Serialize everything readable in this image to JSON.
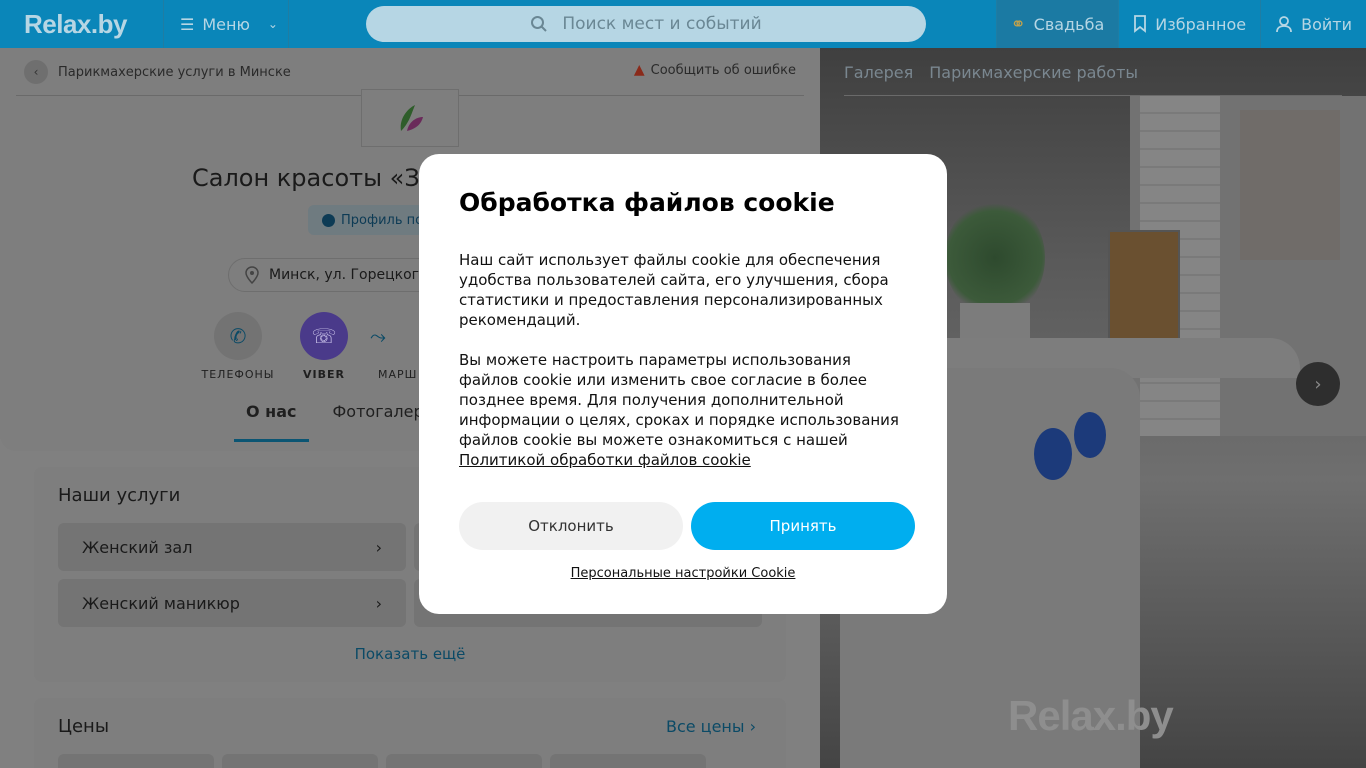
{
  "header": {
    "logo": "Relax.by",
    "menu_label": "Меню",
    "search_placeholder": "Поиск мест и событий",
    "wedding_label": "Свадьба",
    "favorites_label": "Избранное",
    "login_label": "Войти"
  },
  "profile": {
    "breadcrumb": "Парикмахерские услуги в Минске",
    "report_label": "Сообщить об ошибке",
    "title": "Салон красоты «З",
    "verified_label": "Профиль по",
    "address": "Минск, ул. Горецкого",
    "contacts": [
      {
        "label": "ТЕЛЕФОНЫ",
        "icon": "phone-icon"
      },
      {
        "label": "VIBER",
        "icon": "viber-icon"
      },
      {
        "label": "МАРШ",
        "icon": "route-icon"
      }
    ],
    "tabs": [
      {
        "label": "О нас"
      },
      {
        "label": "Фотогалерея"
      }
    ]
  },
  "services": {
    "title": "Наши услуги",
    "items": [
      {
        "label": "Женский зал"
      },
      {
        "label": "Женский маникюр"
      }
    ],
    "show_more": "Показать ещё"
  },
  "prices": {
    "title": "Цены",
    "all_prices": "Все цены"
  },
  "gallery": {
    "nav": [
      "Галерея",
      "Парикмахерские работы"
    ],
    "watermark": "Relax.by"
  },
  "cookie_modal": {
    "title": "Обработка файлов cookie",
    "paragraph1": "Наш сайт использует файлы cookie для обеспечения удобства пользователей сайта, его улучшения, сбора статистики и предоставления персонализированных рекомендаций.",
    "paragraph2": "Вы можете настроить параметры использования файлов cookie или изменить свое согласие в более позднее время. Для получения дополнительной информации о целях, сроках и порядке использования файлов cookie вы можете ознакомиться с нашей",
    "policy_link": "Политикой обработки файлов cookie",
    "decline_label": "Отклонить",
    "accept_label": "Принять",
    "personal_settings": "Персональные настройки Cookie"
  },
  "colors": {
    "header_bg": "#0a86b9",
    "accept_button": "#00aeef",
    "decline_button": "#f1f1f1",
    "viber": "#4a3a8a"
  }
}
